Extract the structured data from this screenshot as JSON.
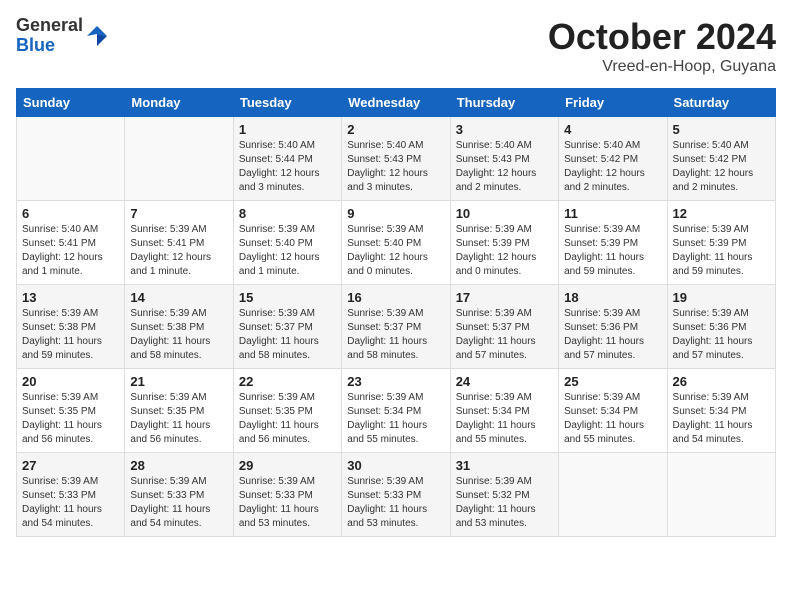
{
  "logo": {
    "general": "General",
    "blue": "Blue"
  },
  "header": {
    "month": "October 2024",
    "location": "Vreed-en-Hoop, Guyana"
  },
  "weekdays": [
    "Sunday",
    "Monday",
    "Tuesday",
    "Wednesday",
    "Thursday",
    "Friday",
    "Saturday"
  ],
  "weeks": [
    [
      {
        "day": "",
        "info": ""
      },
      {
        "day": "",
        "info": ""
      },
      {
        "day": "1",
        "info": "Sunrise: 5:40 AM\nSunset: 5:44 PM\nDaylight: 12 hours\nand 3 minutes."
      },
      {
        "day": "2",
        "info": "Sunrise: 5:40 AM\nSunset: 5:43 PM\nDaylight: 12 hours\nand 3 minutes."
      },
      {
        "day": "3",
        "info": "Sunrise: 5:40 AM\nSunset: 5:43 PM\nDaylight: 12 hours\nand 2 minutes."
      },
      {
        "day": "4",
        "info": "Sunrise: 5:40 AM\nSunset: 5:42 PM\nDaylight: 12 hours\nand 2 minutes."
      },
      {
        "day": "5",
        "info": "Sunrise: 5:40 AM\nSunset: 5:42 PM\nDaylight: 12 hours\nand 2 minutes."
      }
    ],
    [
      {
        "day": "6",
        "info": "Sunrise: 5:40 AM\nSunset: 5:41 PM\nDaylight: 12 hours\nand 1 minute."
      },
      {
        "day": "7",
        "info": "Sunrise: 5:39 AM\nSunset: 5:41 PM\nDaylight: 12 hours\nand 1 minute."
      },
      {
        "day": "8",
        "info": "Sunrise: 5:39 AM\nSunset: 5:40 PM\nDaylight: 12 hours\nand 1 minute."
      },
      {
        "day": "9",
        "info": "Sunrise: 5:39 AM\nSunset: 5:40 PM\nDaylight: 12 hours\nand 0 minutes."
      },
      {
        "day": "10",
        "info": "Sunrise: 5:39 AM\nSunset: 5:39 PM\nDaylight: 12 hours\nand 0 minutes."
      },
      {
        "day": "11",
        "info": "Sunrise: 5:39 AM\nSunset: 5:39 PM\nDaylight: 11 hours\nand 59 minutes."
      },
      {
        "day": "12",
        "info": "Sunrise: 5:39 AM\nSunset: 5:39 PM\nDaylight: 11 hours\nand 59 minutes."
      }
    ],
    [
      {
        "day": "13",
        "info": "Sunrise: 5:39 AM\nSunset: 5:38 PM\nDaylight: 11 hours\nand 59 minutes."
      },
      {
        "day": "14",
        "info": "Sunrise: 5:39 AM\nSunset: 5:38 PM\nDaylight: 11 hours\nand 58 minutes."
      },
      {
        "day": "15",
        "info": "Sunrise: 5:39 AM\nSunset: 5:37 PM\nDaylight: 11 hours\nand 58 minutes."
      },
      {
        "day": "16",
        "info": "Sunrise: 5:39 AM\nSunset: 5:37 PM\nDaylight: 11 hours\nand 58 minutes."
      },
      {
        "day": "17",
        "info": "Sunrise: 5:39 AM\nSunset: 5:37 PM\nDaylight: 11 hours\nand 57 minutes."
      },
      {
        "day": "18",
        "info": "Sunrise: 5:39 AM\nSunset: 5:36 PM\nDaylight: 11 hours\nand 57 minutes."
      },
      {
        "day": "19",
        "info": "Sunrise: 5:39 AM\nSunset: 5:36 PM\nDaylight: 11 hours\nand 57 minutes."
      }
    ],
    [
      {
        "day": "20",
        "info": "Sunrise: 5:39 AM\nSunset: 5:35 PM\nDaylight: 11 hours\nand 56 minutes."
      },
      {
        "day": "21",
        "info": "Sunrise: 5:39 AM\nSunset: 5:35 PM\nDaylight: 11 hours\nand 56 minutes."
      },
      {
        "day": "22",
        "info": "Sunrise: 5:39 AM\nSunset: 5:35 PM\nDaylight: 11 hours\nand 56 minutes."
      },
      {
        "day": "23",
        "info": "Sunrise: 5:39 AM\nSunset: 5:34 PM\nDaylight: 11 hours\nand 55 minutes."
      },
      {
        "day": "24",
        "info": "Sunrise: 5:39 AM\nSunset: 5:34 PM\nDaylight: 11 hours\nand 55 minutes."
      },
      {
        "day": "25",
        "info": "Sunrise: 5:39 AM\nSunset: 5:34 PM\nDaylight: 11 hours\nand 55 minutes."
      },
      {
        "day": "26",
        "info": "Sunrise: 5:39 AM\nSunset: 5:34 PM\nDaylight: 11 hours\nand 54 minutes."
      }
    ],
    [
      {
        "day": "27",
        "info": "Sunrise: 5:39 AM\nSunset: 5:33 PM\nDaylight: 11 hours\nand 54 minutes."
      },
      {
        "day": "28",
        "info": "Sunrise: 5:39 AM\nSunset: 5:33 PM\nDaylight: 11 hours\nand 54 minutes."
      },
      {
        "day": "29",
        "info": "Sunrise: 5:39 AM\nSunset: 5:33 PM\nDaylight: 11 hours\nand 53 minutes."
      },
      {
        "day": "30",
        "info": "Sunrise: 5:39 AM\nSunset: 5:33 PM\nDaylight: 11 hours\nand 53 minutes."
      },
      {
        "day": "31",
        "info": "Sunrise: 5:39 AM\nSunset: 5:32 PM\nDaylight: 11 hours\nand 53 minutes."
      },
      {
        "day": "",
        "info": ""
      },
      {
        "day": "",
        "info": ""
      }
    ]
  ]
}
